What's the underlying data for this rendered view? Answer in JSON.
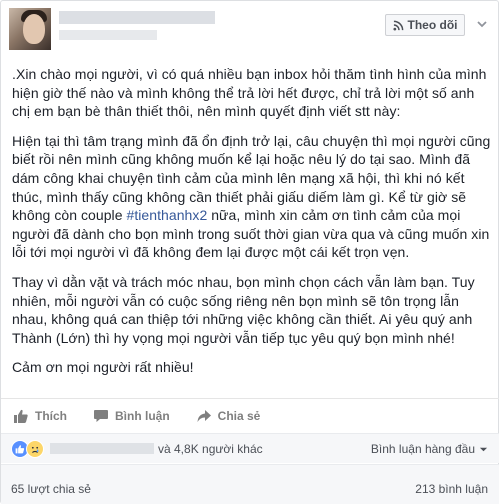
{
  "header": {
    "follow_label": "Theo dõi"
  },
  "post": {
    "paragraphs": [
      ".Xin chào mọi người, vì có quá nhiều bạn inbox hỏi thăm tình hình của mình hiện giờ thế nào và mình không thể trả lời hết được, chỉ trả lời một số anh chị em bạn bè thân thiết thôi, nên mình quyết định viết stt này:",
      null,
      "Thay vì dằn vặt và trách móc nhau, bọn mình chọn cách vẫn làm bạn. Tuy nhiên, mỗi người vẫn có cuộc sống riêng nên bọn mình sẽ tôn trọng lẫn nhau, không quá can thiệp tới những việc không cần thiết. Ai yêu quý anh Thành (Lớn) thì hy vọng mọi người vẫn tiếp tục yêu quý bọn mình nhé!",
      "Cảm ơn mọi người rất nhiều!"
    ],
    "p2_before": "Hiện tại thì tâm trạng mình đã ổn định trở lại, câu chuyện thì mọi người cũng biết rồi nên mình cũng không muốn kể lại hoặc nêu lý do tại sao. Mình đã dám công khai chuyện tình cảm của mình lên mạng xã hội, thì khi nó kết thúc, mình thấy cũng không cần thiết phải giấu diếm làm gì. Kể từ giờ sẽ không còn couple ",
    "p2_hashtag": "#tienthanhx2",
    "p2_after": " nữa, mình xin cảm ơn tình cảm của mọi người đã dành cho bọn mình trong suốt thời gian vừa qua và cũng muốn xin lỗi tới mọi người vì đã không đem lại được một cái kết trọn vẹn."
  },
  "actions": {
    "like": "Thích",
    "comment": "Bình luận",
    "share": "Chia sẻ"
  },
  "reactions": {
    "summary": "và 4,8K người khác",
    "comment_order": "Bình luận hàng đầu"
  },
  "footer": {
    "shares": "65 lượt chia sẻ",
    "comments": "213 bình luận"
  },
  "colors": {
    "link": "#365899",
    "like_blue": "#5890ff",
    "sad_yellow": "#fcd669"
  },
  "icons": [
    "rss-icon",
    "chevron-down-icon",
    "like-icon",
    "comment-icon",
    "share-icon",
    "like-reaction-icon",
    "sad-reaction-icon"
  ]
}
